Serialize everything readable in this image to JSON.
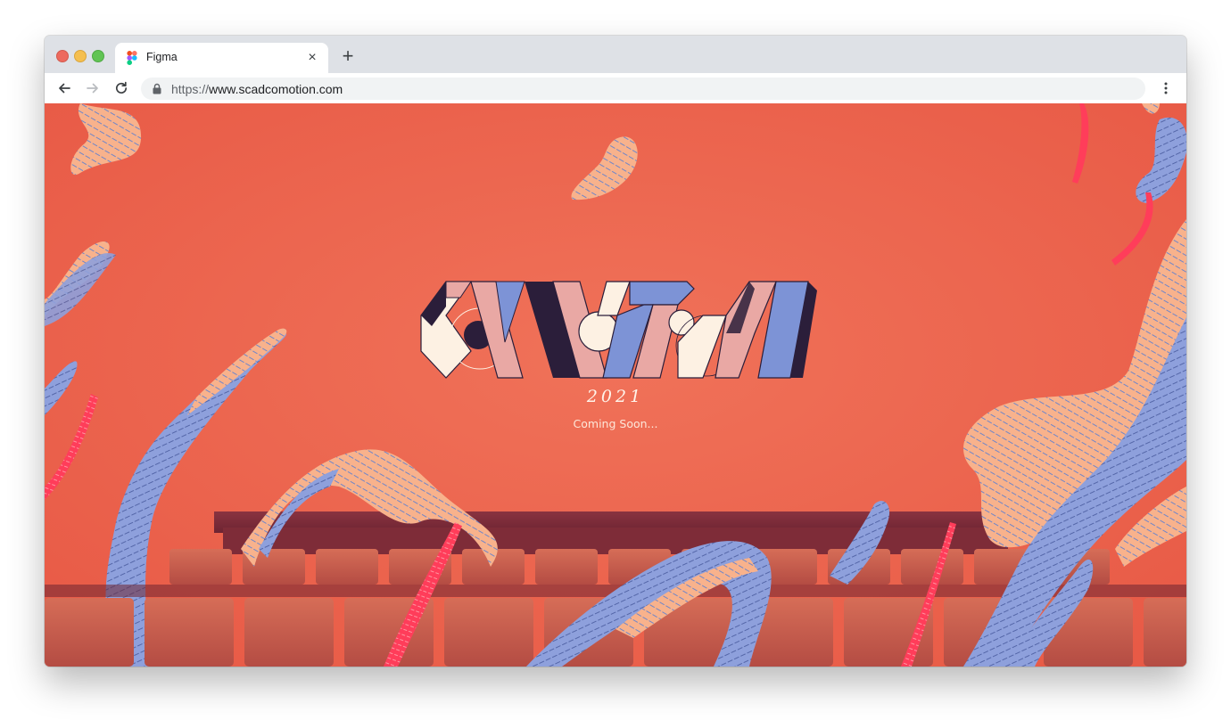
{
  "browser": {
    "tab": {
      "title": "Figma",
      "icon": "figma-logo-icon",
      "close_icon": "close-icon"
    },
    "new_tab_icon": "plus-icon",
    "nav": {
      "back_icon": "arrow-left-icon",
      "forward_icon": "arrow-right-icon",
      "reload_icon": "reload-icon"
    },
    "address": {
      "scheme": "https://",
      "host": "www.scadcomotion.com",
      "lock_icon": "lock-icon"
    },
    "menu_icon": "kebab-menu-icon"
  },
  "page": {
    "logo_alt": "MOTION",
    "year": "2021",
    "subtitle": "Coming Soon..."
  },
  "colors": {
    "background": "#ee6850",
    "navy": "#2b1e3a",
    "periwinkle": "#7d93d6",
    "pink": "#e9a8a4",
    "cream": "#fdf1e3",
    "peach": "#f8b28c",
    "seat_dark": "#7a2a36",
    "seat_light": "#c9604f",
    "ribbon_red": "#ff3d5a"
  }
}
